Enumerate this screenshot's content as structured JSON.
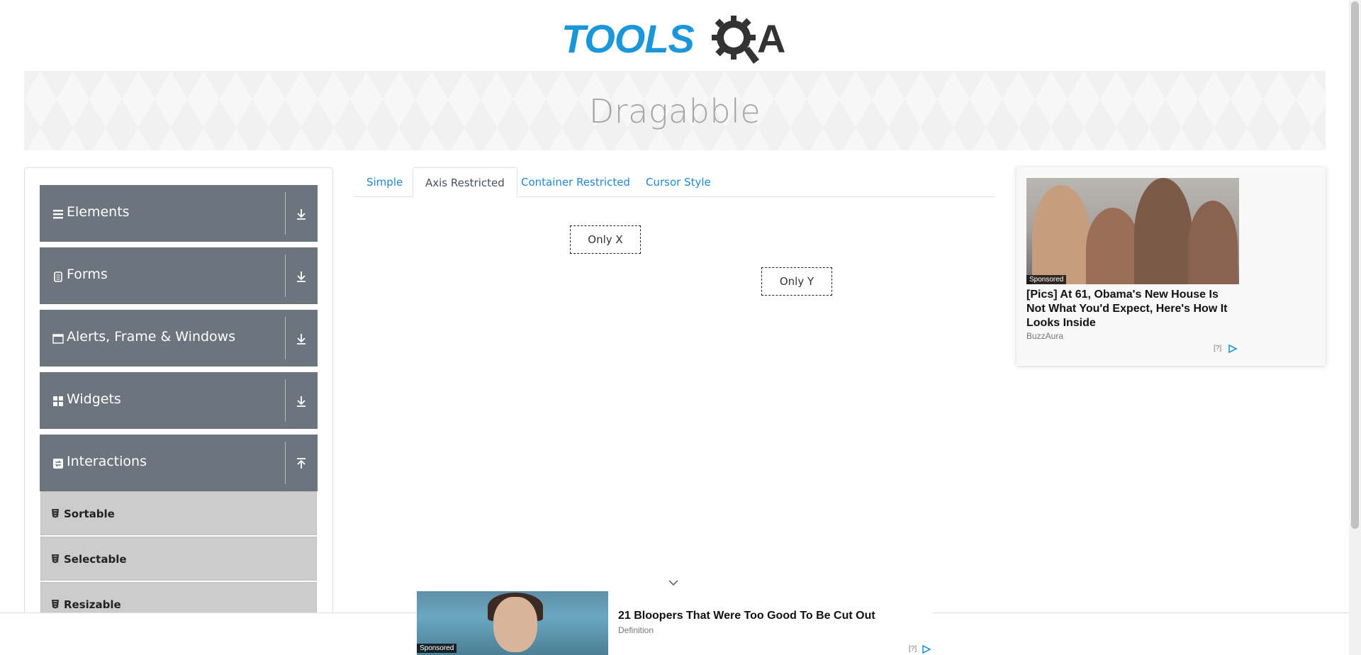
{
  "logo": {
    "text": "TOOLS",
    "suffix": "A"
  },
  "banner": {
    "title": "Dragabble"
  },
  "sidebar": {
    "groups": [
      {
        "label": "Elements",
        "icon": "hamburger-icon",
        "expanded": false
      },
      {
        "label": "Forms",
        "icon": "document-icon",
        "expanded": false
      },
      {
        "label": "Alerts, Frame & Windows",
        "icon": "window-icon",
        "expanded": false
      },
      {
        "label": "Widgets",
        "icon": "grid-icon",
        "expanded": false
      },
      {
        "label": "Interactions",
        "icon": "interactions-icon",
        "expanded": true
      }
    ],
    "sub_items": [
      {
        "label": "Sortable",
        "icon": "html5-icon"
      },
      {
        "label": "Selectable",
        "icon": "html5-icon"
      },
      {
        "label": "Resizable",
        "icon": "html5-icon"
      }
    ]
  },
  "tabs": [
    {
      "label": "Simple",
      "active": false
    },
    {
      "label": "Axis Restricted",
      "active": true
    },
    {
      "label": "Container Restricted",
      "active": false
    },
    {
      "label": "Cursor Style",
      "active": false
    }
  ],
  "drag_boxes": {
    "only_x": "Only X",
    "only_y": "Only Y"
  },
  "ad_right": {
    "badge": "Sponsored",
    "headline": "[Pics] At 61, Obama's New House Is Not What You'd Expect, Here's How It Looks Inside",
    "source": "BuzzAura",
    "choice": "[?]"
  },
  "ad_bottom": {
    "badge": "Sponsored",
    "headline": "21 Bloopers That Were Too Good To Be Cut Out",
    "source": "Definition",
    "choice": "[?]"
  },
  "colors": {
    "brand_blue": "#1b96d8",
    "sidebar_group": "#6c757d",
    "sidebar_sub": "#cccccc",
    "tab_link": "#1f88d6"
  }
}
